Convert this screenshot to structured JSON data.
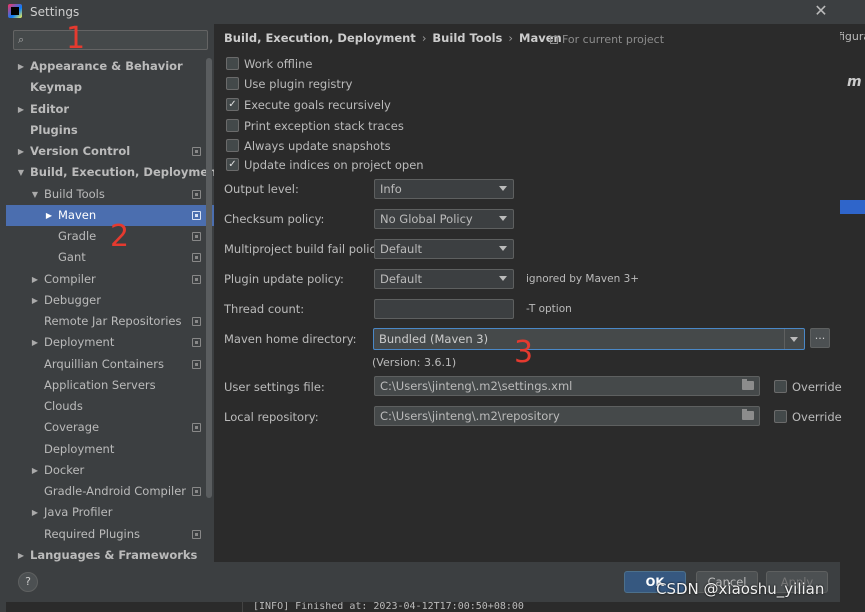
{
  "window": {
    "title": "Settings",
    "close_glyph": "✕"
  },
  "search": {
    "placeholder": ""
  },
  "tree": {
    "items": [
      {
        "label": "Appearance & Behavior",
        "indent": 0,
        "arrow": "▶",
        "bold": true,
        "project": false
      },
      {
        "label": "Keymap",
        "indent": 0,
        "arrow": "",
        "bold": true,
        "project": false
      },
      {
        "label": "Editor",
        "indent": 0,
        "arrow": "▶",
        "bold": true,
        "project": false
      },
      {
        "label": "Plugins",
        "indent": 0,
        "arrow": "",
        "bold": true,
        "project": false
      },
      {
        "label": "Version Control",
        "indent": 0,
        "arrow": "▶",
        "bold": true,
        "project": true
      },
      {
        "label": "Build, Execution, Deployment",
        "indent": 0,
        "arrow": "▼",
        "bold": true,
        "project": false
      },
      {
        "label": "Build Tools",
        "indent": 1,
        "arrow": "▼",
        "bold": false,
        "project": true
      },
      {
        "label": "Maven",
        "indent": 2,
        "arrow": "▶",
        "bold": false,
        "project": true,
        "selected": true
      },
      {
        "label": "Gradle",
        "indent": 2,
        "arrow": "",
        "bold": false,
        "project": true
      },
      {
        "label": "Gant",
        "indent": 2,
        "arrow": "",
        "bold": false,
        "project": true
      },
      {
        "label": "Compiler",
        "indent": 1,
        "arrow": "▶",
        "bold": false,
        "project": true
      },
      {
        "label": "Debugger",
        "indent": 1,
        "arrow": "▶",
        "bold": false,
        "project": false
      },
      {
        "label": "Remote Jar Repositories",
        "indent": 1,
        "arrow": "",
        "bold": false,
        "project": true
      },
      {
        "label": "Deployment",
        "indent": 1,
        "arrow": "▶",
        "bold": false,
        "project": true
      },
      {
        "label": "Arquillian Containers",
        "indent": 1,
        "arrow": "",
        "bold": false,
        "project": true
      },
      {
        "label": "Application Servers",
        "indent": 1,
        "arrow": "",
        "bold": false,
        "project": false
      },
      {
        "label": "Clouds",
        "indent": 1,
        "arrow": "",
        "bold": false,
        "project": false
      },
      {
        "label": "Coverage",
        "indent": 1,
        "arrow": "",
        "bold": false,
        "project": true
      },
      {
        "label": "Deployment",
        "indent": 1,
        "arrow": "",
        "bold": false,
        "project": false
      },
      {
        "label": "Docker",
        "indent": 1,
        "arrow": "▶",
        "bold": false,
        "project": false
      },
      {
        "label": "Gradle-Android Compiler",
        "indent": 1,
        "arrow": "",
        "bold": false,
        "project": true
      },
      {
        "label": "Java Profiler",
        "indent": 1,
        "arrow": "▶",
        "bold": false,
        "project": false
      },
      {
        "label": "Required Plugins",
        "indent": 1,
        "arrow": "",
        "bold": false,
        "project": true
      },
      {
        "label": "Languages & Frameworks",
        "indent": 0,
        "arrow": "▶",
        "bold": true,
        "project": false
      }
    ]
  },
  "breadcrumb": {
    "part1": "Build, Execution, Deployment",
    "part2": "Build Tools",
    "part3": "Maven",
    "sep": "›"
  },
  "for_project": "For current project",
  "checkboxes": [
    {
      "label": "Work offline",
      "checked": false
    },
    {
      "label": "Use plugin registry",
      "checked": false
    },
    {
      "label": "Execute goals recursively",
      "checked": true
    },
    {
      "label": "Print exception stack traces",
      "checked": false
    },
    {
      "label": "Always update snapshots",
      "checked": false
    },
    {
      "label": "Update indices on project open",
      "checked": true
    }
  ],
  "check_glyph": "✓",
  "fields": {
    "output_level": {
      "label": "Output level:",
      "value": "Info"
    },
    "checksum_policy": {
      "label": "Checksum policy:",
      "value": "No Global Policy"
    },
    "multiproject_policy": {
      "label": "Multiproject build fail policy:",
      "value": "Default"
    },
    "plugin_update_policy": {
      "label": "Plugin update policy:",
      "value": "Default",
      "hint": "ignored by Maven 3+"
    },
    "thread_count": {
      "label": "Thread count:",
      "value": "",
      "hint": "-T option"
    },
    "maven_home": {
      "label": "Maven home directory:",
      "value": "Bundled (Maven 3)",
      "version": "(Version: 3.6.1)",
      "browse": "..."
    },
    "user_settings": {
      "label": "User settings file:",
      "value": "C:\\Users\\jinteng\\.m2\\settings.xml",
      "override": "Override"
    },
    "local_repo": {
      "label": "Local repository:",
      "value": "C:\\Users\\jinteng\\.m2\\repository",
      "override": "Override"
    }
  },
  "buttons": {
    "help": "?",
    "ok": "OK",
    "cancel": "Cancel",
    "apply": "Apply"
  },
  "background_fragments": {
    "right_tab": "figura",
    "right_m": "m",
    "console": "[INFO] Finished at: 2023-04-12T17:00:50+08:00"
  },
  "annotations": {
    "a1": "1",
    "a2": "2",
    "a3": "3"
  },
  "watermark": "CSDN @xiaoshu_yilian",
  "colors": {
    "selection": "#4b6eaf",
    "accent": "#365880",
    "annotation": "#e53a2f"
  }
}
